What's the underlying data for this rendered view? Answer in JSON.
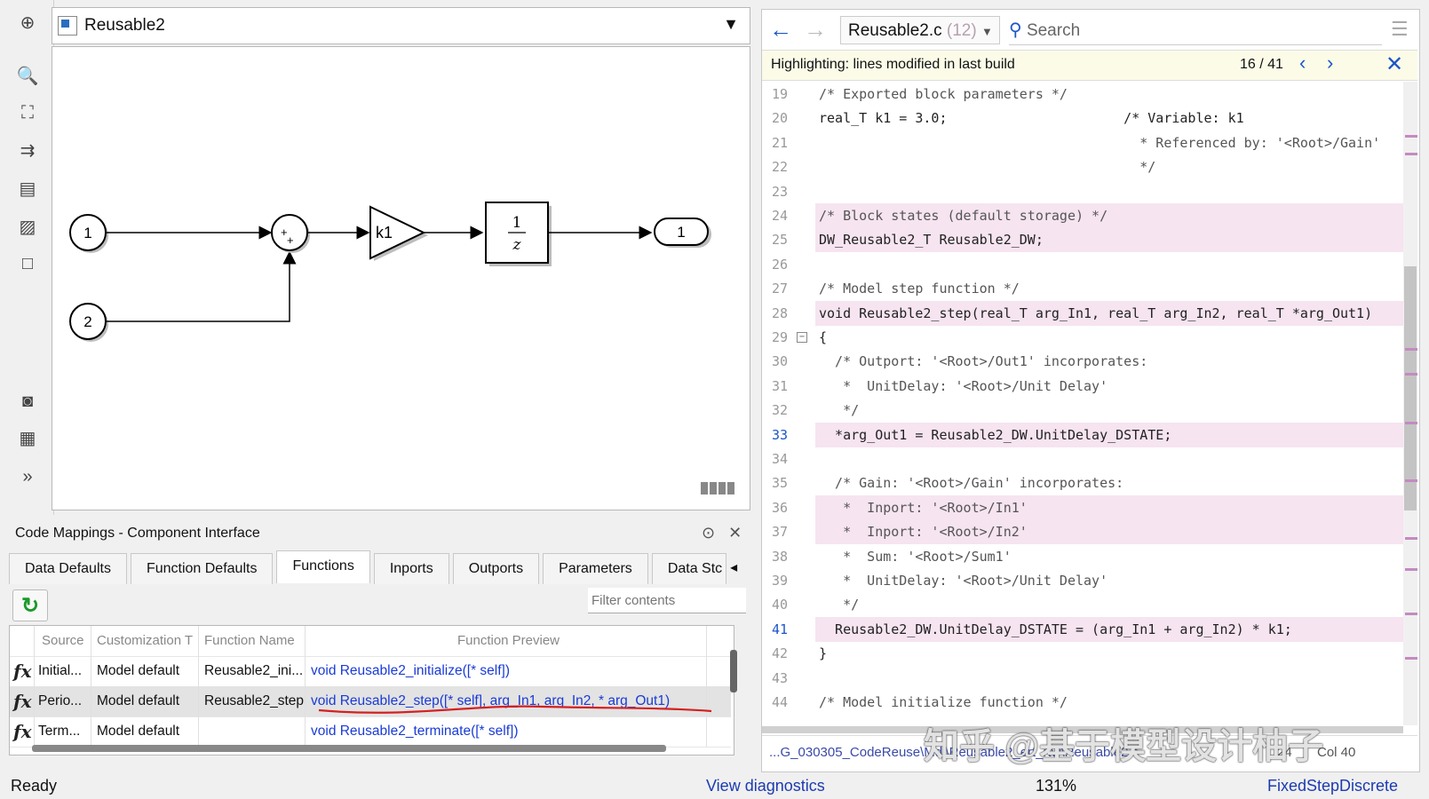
{
  "model": {
    "name": "Reusable2",
    "blocks": {
      "inport1": "1",
      "inport2": "2",
      "sum_signs": "+ +",
      "gain": "k1",
      "delay_num": "1",
      "delay_den": "z",
      "outport1": "1"
    }
  },
  "code_mappings": {
    "title": "Code Mappings - Component Interface",
    "tabs": [
      "Data Defaults",
      "Function Defaults",
      "Functions",
      "Inports",
      "Outports",
      "Parameters",
      "Data Stc"
    ],
    "active_tab": "Functions",
    "filter_placeholder": "Filter contents",
    "columns": [
      "Source",
      "Customization T",
      "Function Name",
      "Function Preview"
    ],
    "rows": [
      {
        "source": "Initial...",
        "customization": "Model default",
        "function_name": "Reusable2_ini...",
        "preview": "void Reusable2_initialize([* self])"
      },
      {
        "source": "Perio...",
        "customization": "Model default",
        "function_name": "Reusable2_step",
        "preview": "void Reusable2_step([* self], arg_In1, arg_In2, * arg_Out1)"
      },
      {
        "source": "Term...",
        "customization": "Model default",
        "function_name": "",
        "preview": "void Reusable2_terminate([* self])"
      }
    ]
  },
  "status_bar": {
    "left": "Ready",
    "diagnostics": "View diagnostics",
    "zoom": "131%",
    "solver": "FixedStepDiscrete"
  },
  "code_view": {
    "file": "Reusable2.c",
    "file_count": "(12)",
    "search_placeholder": "Search",
    "highlight_text": "Highlighting: lines modified in last build",
    "match_position": "16 / 41",
    "footer_path": "...G_030305_CodeReuse\\Mdl\\Reusable2_ert_rtw\\Reusable2.c",
    "footer_ln": "24",
    "footer_col": "Col 40",
    "watermark": "知乎 @基于模型设计柚子",
    "lines": [
      {
        "n": "19",
        "text": "/* Exported block parameters */",
        "hl": false,
        "comment": true
      },
      {
        "n": "20",
        "text": "real_T k1 = 3.0;                      /* Variable: k1",
        "hl": false,
        "comment": false
      },
      {
        "n": "21",
        "text": "                                        * Referenced by: '<Root>/Gain'",
        "hl": false,
        "comment": true
      },
      {
        "n": "22",
        "text": "                                        */",
        "hl": false,
        "comment": true
      },
      {
        "n": "23",
        "text": "",
        "hl": false,
        "comment": false
      },
      {
        "n": "24",
        "text": "/* Block states (default storage) */",
        "hl": true,
        "comment": true
      },
      {
        "n": "25",
        "text": "DW_Reusable2_T Reusable2_DW;",
        "hl": true,
        "comment": false
      },
      {
        "n": "26",
        "text": "",
        "hl": false,
        "comment": false
      },
      {
        "n": "27",
        "text": "/* Model step function */",
        "hl": false,
        "comment": true
      },
      {
        "n": "28",
        "text": "void Reusable2_step(real_T arg_In1, real_T arg_In2, real_T *arg_Out1)",
        "hl": true,
        "comment": false
      },
      {
        "n": "29",
        "text": "{",
        "hl": false,
        "comment": false
      },
      {
        "n": "30",
        "text": "  /* Outport: '<Root>/Out1' incorporates:",
        "hl": false,
        "comment": true
      },
      {
        "n": "31",
        "text": "   *  UnitDelay: '<Root>/Unit Delay'",
        "hl": false,
        "comment": true
      },
      {
        "n": "32",
        "text": "   */",
        "hl": false,
        "comment": true
      },
      {
        "n": "33",
        "text": "  *arg_Out1 = Reusable2_DW.UnitDelay_DSTATE;",
        "hl": true,
        "comment": false
      },
      {
        "n": "34",
        "text": "",
        "hl": false,
        "comment": false
      },
      {
        "n": "35",
        "text": "  /* Gain: '<Root>/Gain' incorporates:",
        "hl": false,
        "comment": true
      },
      {
        "n": "36",
        "text": "   *  Inport: '<Root>/In1'",
        "hl": true,
        "comment": true
      },
      {
        "n": "37",
        "text": "   *  Inport: '<Root>/In2'",
        "hl": true,
        "comment": true
      },
      {
        "n": "38",
        "text": "   *  Sum: '<Root>/Sum1'",
        "hl": false,
        "comment": true
      },
      {
        "n": "39",
        "text": "   *  UnitDelay: '<Root>/Unit Delay'",
        "hl": false,
        "comment": true
      },
      {
        "n": "40",
        "text": "   */",
        "hl": false,
        "comment": true
      },
      {
        "n": "41",
        "text": "  Reusable2_DW.UnitDelay_DSTATE = (arg_In1 + arg_In2) * k1;",
        "hl": true,
        "comment": false
      },
      {
        "n": "42",
        "text": "}",
        "hl": false,
        "comment": false
      },
      {
        "n": "43",
        "text": "",
        "hl": false,
        "comment": false
      },
      {
        "n": "44",
        "text": "/* Model initialize function */",
        "hl": false,
        "comment": true
      }
    ]
  },
  "colors": {
    "highlight": "#f6e4f0",
    "link_blue": "#1a3bd6",
    "annotation_red": "#d42020"
  }
}
